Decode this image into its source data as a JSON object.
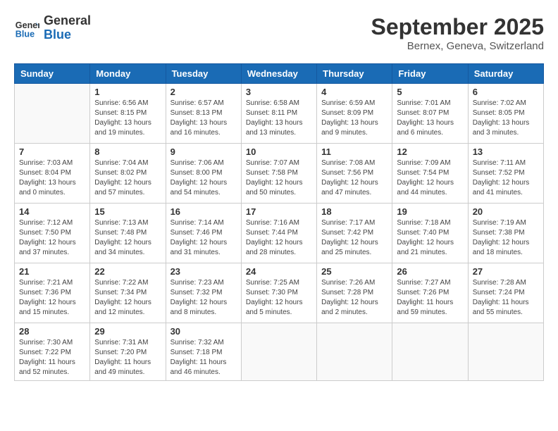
{
  "header": {
    "logo_general": "General",
    "logo_blue": "Blue",
    "month_year": "September 2025",
    "location": "Bernex, Geneva, Switzerland"
  },
  "weekdays": [
    "Sunday",
    "Monday",
    "Tuesday",
    "Wednesday",
    "Thursday",
    "Friday",
    "Saturday"
  ],
  "weeks": [
    [
      {
        "day": "",
        "info": ""
      },
      {
        "day": "1",
        "info": "Sunrise: 6:56 AM\nSunset: 8:15 PM\nDaylight: 13 hours\nand 19 minutes."
      },
      {
        "day": "2",
        "info": "Sunrise: 6:57 AM\nSunset: 8:13 PM\nDaylight: 13 hours\nand 16 minutes."
      },
      {
        "day": "3",
        "info": "Sunrise: 6:58 AM\nSunset: 8:11 PM\nDaylight: 13 hours\nand 13 minutes."
      },
      {
        "day": "4",
        "info": "Sunrise: 6:59 AM\nSunset: 8:09 PM\nDaylight: 13 hours\nand 9 minutes."
      },
      {
        "day": "5",
        "info": "Sunrise: 7:01 AM\nSunset: 8:07 PM\nDaylight: 13 hours\nand 6 minutes."
      },
      {
        "day": "6",
        "info": "Sunrise: 7:02 AM\nSunset: 8:05 PM\nDaylight: 13 hours\nand 3 minutes."
      }
    ],
    [
      {
        "day": "7",
        "info": "Sunrise: 7:03 AM\nSunset: 8:04 PM\nDaylight: 13 hours\nand 0 minutes."
      },
      {
        "day": "8",
        "info": "Sunrise: 7:04 AM\nSunset: 8:02 PM\nDaylight: 12 hours\nand 57 minutes."
      },
      {
        "day": "9",
        "info": "Sunrise: 7:06 AM\nSunset: 8:00 PM\nDaylight: 12 hours\nand 54 minutes."
      },
      {
        "day": "10",
        "info": "Sunrise: 7:07 AM\nSunset: 7:58 PM\nDaylight: 12 hours\nand 50 minutes."
      },
      {
        "day": "11",
        "info": "Sunrise: 7:08 AM\nSunset: 7:56 PM\nDaylight: 12 hours\nand 47 minutes."
      },
      {
        "day": "12",
        "info": "Sunrise: 7:09 AM\nSunset: 7:54 PM\nDaylight: 12 hours\nand 44 minutes."
      },
      {
        "day": "13",
        "info": "Sunrise: 7:11 AM\nSunset: 7:52 PM\nDaylight: 12 hours\nand 41 minutes."
      }
    ],
    [
      {
        "day": "14",
        "info": "Sunrise: 7:12 AM\nSunset: 7:50 PM\nDaylight: 12 hours\nand 37 minutes."
      },
      {
        "day": "15",
        "info": "Sunrise: 7:13 AM\nSunset: 7:48 PM\nDaylight: 12 hours\nand 34 minutes."
      },
      {
        "day": "16",
        "info": "Sunrise: 7:14 AM\nSunset: 7:46 PM\nDaylight: 12 hours\nand 31 minutes."
      },
      {
        "day": "17",
        "info": "Sunrise: 7:16 AM\nSunset: 7:44 PM\nDaylight: 12 hours\nand 28 minutes."
      },
      {
        "day": "18",
        "info": "Sunrise: 7:17 AM\nSunset: 7:42 PM\nDaylight: 12 hours\nand 25 minutes."
      },
      {
        "day": "19",
        "info": "Sunrise: 7:18 AM\nSunset: 7:40 PM\nDaylight: 12 hours\nand 21 minutes."
      },
      {
        "day": "20",
        "info": "Sunrise: 7:19 AM\nSunset: 7:38 PM\nDaylight: 12 hours\nand 18 minutes."
      }
    ],
    [
      {
        "day": "21",
        "info": "Sunrise: 7:21 AM\nSunset: 7:36 PM\nDaylight: 12 hours\nand 15 minutes."
      },
      {
        "day": "22",
        "info": "Sunrise: 7:22 AM\nSunset: 7:34 PM\nDaylight: 12 hours\nand 12 minutes."
      },
      {
        "day": "23",
        "info": "Sunrise: 7:23 AM\nSunset: 7:32 PM\nDaylight: 12 hours\nand 8 minutes."
      },
      {
        "day": "24",
        "info": "Sunrise: 7:25 AM\nSunset: 7:30 PM\nDaylight: 12 hours\nand 5 minutes."
      },
      {
        "day": "25",
        "info": "Sunrise: 7:26 AM\nSunset: 7:28 PM\nDaylight: 12 hours\nand 2 minutes."
      },
      {
        "day": "26",
        "info": "Sunrise: 7:27 AM\nSunset: 7:26 PM\nDaylight: 11 hours\nand 59 minutes."
      },
      {
        "day": "27",
        "info": "Sunrise: 7:28 AM\nSunset: 7:24 PM\nDaylight: 11 hours\nand 55 minutes."
      }
    ],
    [
      {
        "day": "28",
        "info": "Sunrise: 7:30 AM\nSunset: 7:22 PM\nDaylight: 11 hours\nand 52 minutes."
      },
      {
        "day": "29",
        "info": "Sunrise: 7:31 AM\nSunset: 7:20 PM\nDaylight: 11 hours\nand 49 minutes."
      },
      {
        "day": "30",
        "info": "Sunrise: 7:32 AM\nSunset: 7:18 PM\nDaylight: 11 hours\nand 46 minutes."
      },
      {
        "day": "",
        "info": ""
      },
      {
        "day": "",
        "info": ""
      },
      {
        "day": "",
        "info": ""
      },
      {
        "day": "",
        "info": ""
      }
    ]
  ]
}
